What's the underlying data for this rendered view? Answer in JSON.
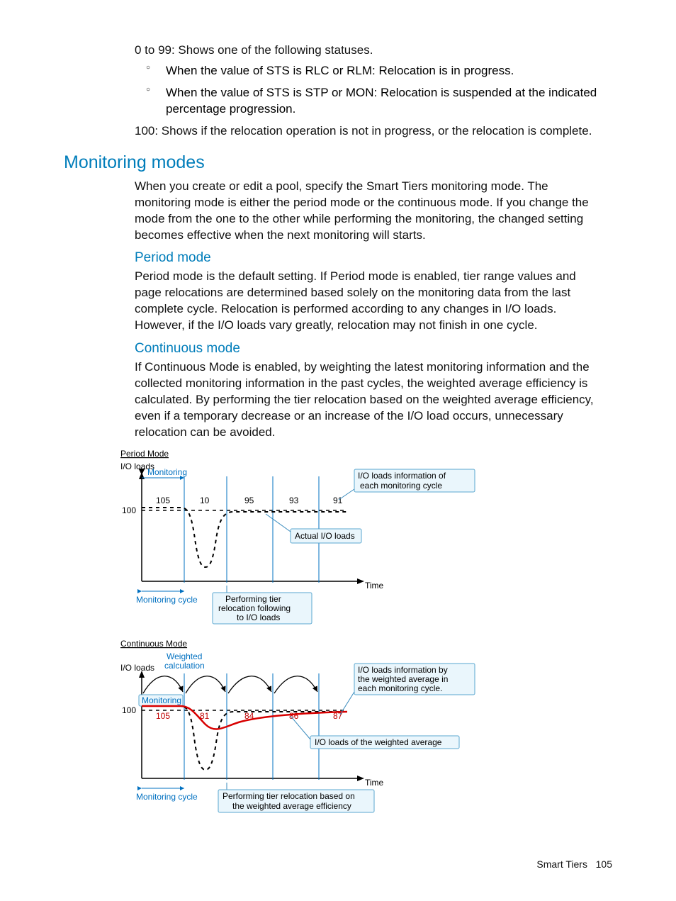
{
  "intro": {
    "range_line": "0 to 99: Shows one of the following statuses.",
    "li1": "When the value of STS is RLC or RLM: Relocation is in progress.",
    "li2": "When the value of STS is STP or MON: Relocation is suspended at the indicated percentage progression.",
    "hundred": "100: Shows if the relocation operation is not in progress, or the relocation is complete."
  },
  "h2_monitoring": "Monitoring modes",
  "monitoring_para": "When you create or edit a pool, specify the Smart Tiers monitoring mode. The monitoring mode is either the period mode or the continuous mode. If you change the mode from the one to the other while performing the monitoring, the changed setting becomes effective when the next monitoring will starts.",
  "h3_period": "Period mode",
  "period_para": "Period mode is the default setting. If Period mode is enabled, tier range values and page relocations are determined based solely on the monitoring data from the last complete cycle. Relocation is performed according to any changes in I/O loads. However, if the I/O loads vary greatly, relocation may not finish in one cycle.",
  "h3_cont": "Continuous mode",
  "cont_para": "If Continuous Mode is enabled, by weighting the latest monitoring information and the collected monitoring information in the past cycles, the weighted average efficiency is calculated. By performing the tier relocation based on the weighted average efficiency, even if a temporary decrease or an increase of the I/O load occurs, unnecessary relocation can be avoided.",
  "footer": {
    "section": "Smart Tiers",
    "page": "105"
  },
  "chart_data": [
    {
      "type": "line",
      "title": "Period Mode",
      "ylabel": "I/O loads",
      "xlabel": "Time",
      "ylim": [
        0,
        110
      ],
      "reference_line": 100,
      "monitoring_labels": [
        "105",
        "10",
        "95",
        "93",
        "91"
      ],
      "series": [
        {
          "name": "Actual I/O loads",
          "style": "dashed-black"
        }
      ],
      "annotations": [
        "Monitoring",
        "Monitoring cycle",
        "Performing tier relocation following to I/O loads",
        "I/O loads information of each monitoring cycle",
        "Actual I/O loads"
      ]
    },
    {
      "type": "line",
      "title": "Continuous Mode",
      "ylabel": "I/O loads",
      "xlabel": "Time",
      "ylim": [
        0,
        110
      ],
      "reference_line": 100,
      "monitoring_labels": [
        "105",
        "81",
        "84",
        "86",
        "87"
      ],
      "series": [
        {
          "name": "Actual I/O loads",
          "style": "dashed-black"
        },
        {
          "name": "I/O loads of the weighted average",
          "style": "solid-red"
        }
      ],
      "annotations": [
        "Weighted calculation",
        "Monitoring",
        "Monitoring cycle",
        "Performing tier relocation based on the weighted average efficiency",
        "I/O loads information by the weighted average in each monitoring cycle.",
        "I/O loads of the weighted average"
      ]
    }
  ]
}
